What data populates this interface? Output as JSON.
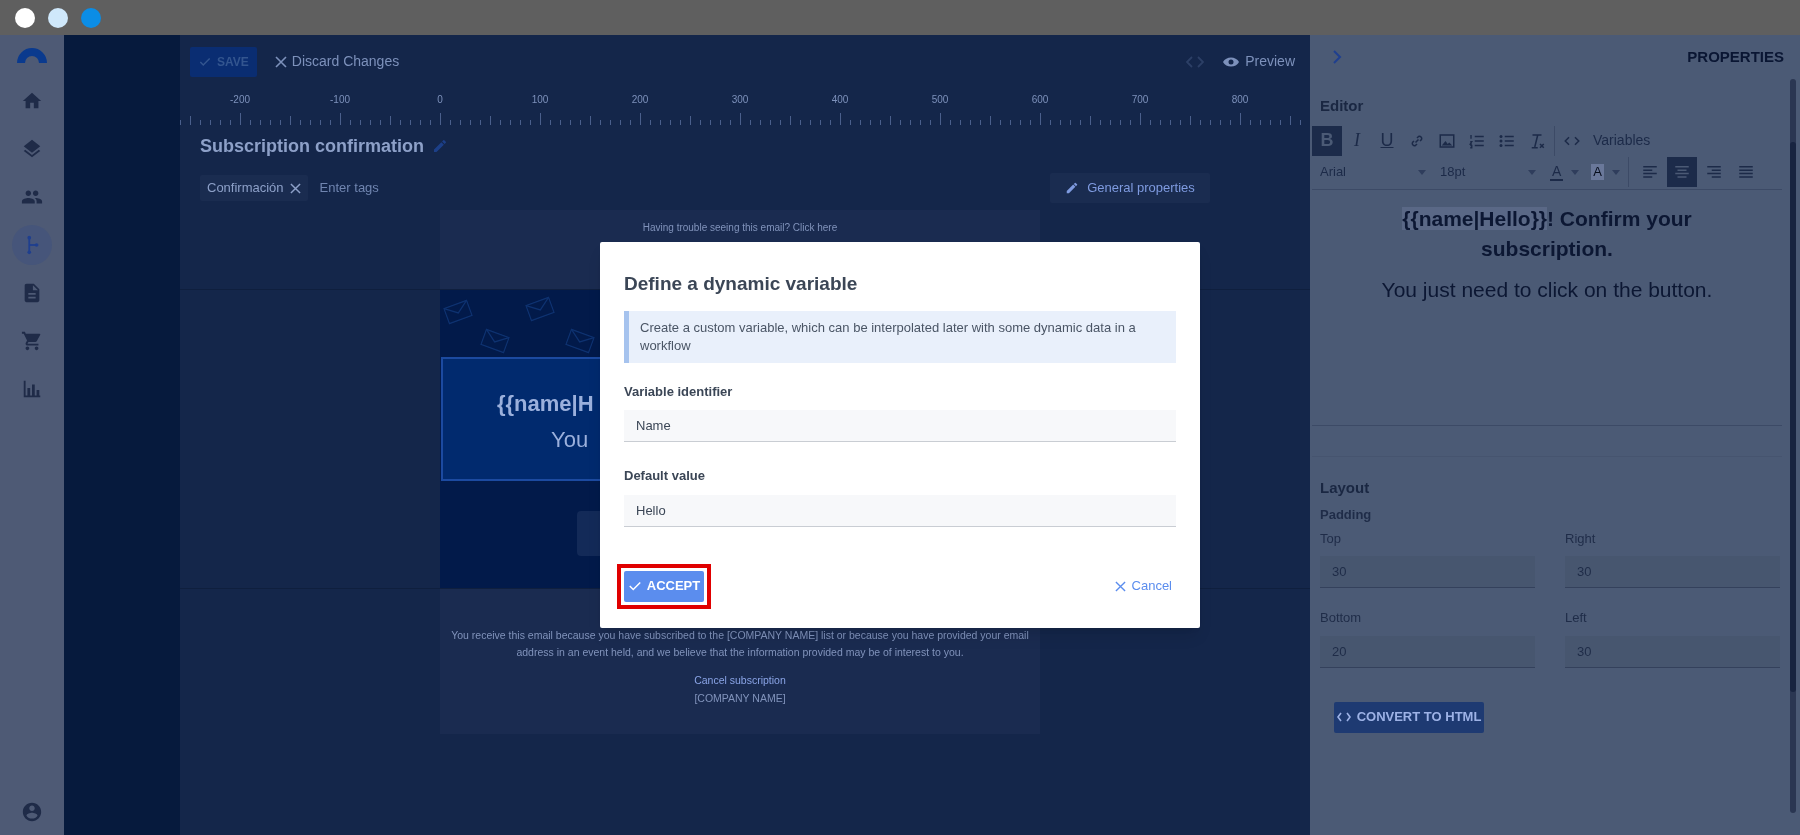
{
  "window_controls": [
    {
      "color": "#ffffff"
    },
    {
      "color": "#cfe8fb"
    },
    {
      "color": "#0b8de6"
    }
  ],
  "nav": {
    "items": [
      {
        "selected": false
      },
      {
        "selected": false
      },
      {
        "selected": false
      },
      {
        "selected": true
      },
      {
        "selected": false
      },
      {
        "selected": false
      },
      {
        "selected": false
      }
    ]
  },
  "toolbar": {
    "save": "SAVE",
    "discard": "Discard Changes",
    "preview": "Preview"
  },
  "ruler": {
    "labels": [
      "-200",
      "-100",
      "0",
      "100",
      "200",
      "300",
      "400",
      "500",
      "600",
      "700",
      "800"
    ]
  },
  "template": {
    "title": "Subscription confirmation",
    "tags": [
      "Confirmación"
    ],
    "tag_placeholder": "Enter tags",
    "general_properties": "General properties"
  },
  "email": {
    "preheader": "Having trouble seeing this email? Click",
    "preheader_link": "here",
    "heading": "{{name|H",
    "body": "You",
    "footer_text": "You receive this email because you have subscribed to the [COMPANY NAME] list or because you have provided your email address in an event held, and we believe that the information provided may be of interest to you.",
    "cancel_link": "Cancel subscription",
    "company": "[COMPANY NAME]"
  },
  "dialog": {
    "title": "Define a dynamic variable",
    "info": "Create a custom variable, which can be interpolated later with some dynamic data in a workflow",
    "fields": [
      {
        "label": "Variable identifier",
        "value": "Name"
      },
      {
        "label": "Default value",
        "value": "Hello"
      }
    ],
    "accept": "ACCEPT",
    "cancel": "Cancel"
  },
  "properties": {
    "title": "PROPERTIES",
    "editor": {
      "heading": "Editor",
      "format_buttons": [
        {
          "label": "B",
          "selected": true
        },
        {
          "label": "I",
          "selected": false
        },
        {
          "label": "U",
          "selected": false
        }
      ],
      "variables": "Variables",
      "font": "Arial",
      "size": "18pt",
      "text_color": "A",
      "highlight_color": "A",
      "alignment": [
        {
          "selected": false
        },
        {
          "selected": true
        },
        {
          "selected": false
        },
        {
          "selected": false
        }
      ],
      "content_variable": "{{name|Hello}}",
      "content_heading": "! Confirm your subscription.",
      "content_body": "You just need to click on the button."
    },
    "layout": {
      "heading": "Layout",
      "padding_label": "Padding",
      "fields": [
        {
          "label": "Top",
          "value": "30"
        },
        {
          "label": "Right",
          "value": "30"
        },
        {
          "label": "Bottom",
          "value": "20"
        },
        {
          "label": "Left",
          "value": "30"
        }
      ]
    },
    "convert": "CONVERT TO HTML"
  }
}
